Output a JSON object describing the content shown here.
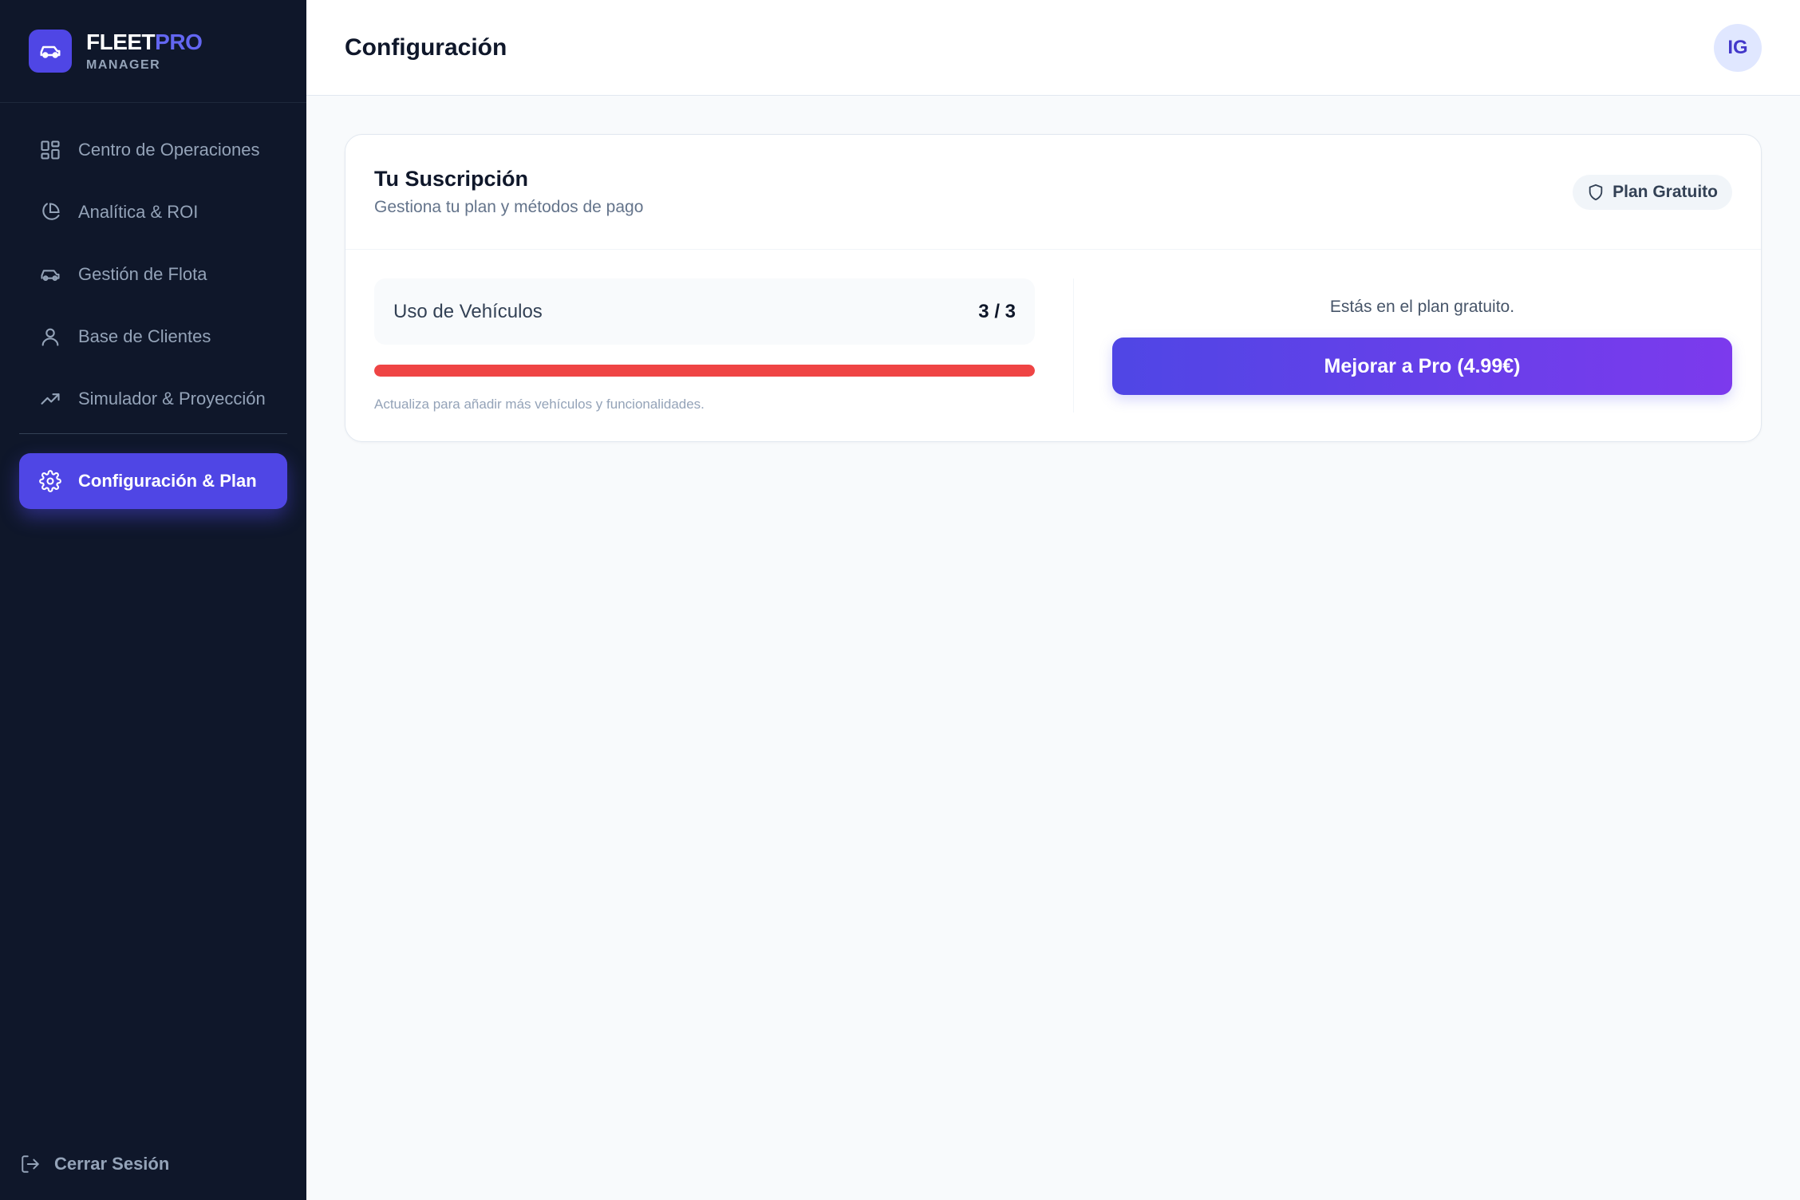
{
  "brand": {
    "name_main": "FLEET",
    "name_accent": "PRO",
    "subtitle": "MANAGER"
  },
  "sidebar": {
    "items": [
      {
        "label": "Centro de Operaciones",
        "icon": "grid-icon"
      },
      {
        "label": "Analítica & ROI",
        "icon": "pie-chart-icon"
      },
      {
        "label": "Gestión de Flota",
        "icon": "car-icon"
      },
      {
        "label": "Base de Clientes",
        "icon": "user-icon"
      },
      {
        "label": "Simulador & Proyección",
        "icon": "trending-up-icon"
      },
      {
        "label": "Configuración & Plan",
        "icon": "gear-icon",
        "active": true
      }
    ],
    "logout_label": "Cerrar Sesión"
  },
  "header": {
    "title": "Configuración",
    "avatar_initials": "IG"
  },
  "subscription": {
    "title": "Tu Suscripción",
    "subtitle": "Gestiona tu plan y métodos de pago",
    "badge": "Plan Gratuito",
    "usage_label": "Uso de Vehículos",
    "usage_value": "3 / 3",
    "usage_fraction": 1.0,
    "usage_note": "Actualiza para añadir más vehículos y funcionalidades.",
    "plan_text": "Estás en el plan gratuito.",
    "upgrade_button": "Mejorar a Pro (4.99€)"
  },
  "colors": {
    "sidebar_bg": "#0f172a",
    "accent": "#4f46e5",
    "progress_fill": "#ef4444",
    "gradient_end": "#7c3aed"
  }
}
